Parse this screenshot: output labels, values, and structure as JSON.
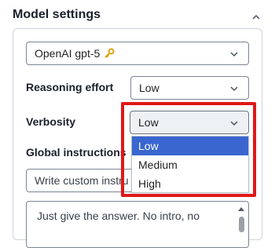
{
  "header": {
    "title": "Model settings"
  },
  "model_select": {
    "value": "OpenAI gpt-5"
  },
  "reasoning": {
    "label": "Reasoning effort",
    "value": "Low"
  },
  "verbosity": {
    "label": "Verbosity",
    "value": "Low",
    "options": [
      "Low",
      "Medium",
      "High"
    ],
    "selected": "Low"
  },
  "global": {
    "label": "Global instructions",
    "placeholder": "Write custom instru",
    "textarea_text": "Just give the answer. No intro, no"
  },
  "icons": {
    "collapse": "chevron-up-icon",
    "dropdown": "chevron-down-icon",
    "model_key": "key-icon",
    "scroll_up": "scroll-up-arrow-icon"
  },
  "colors": {
    "selected_option": "#3966cf",
    "highlight": "#e01818",
    "key": "#d9a514"
  }
}
